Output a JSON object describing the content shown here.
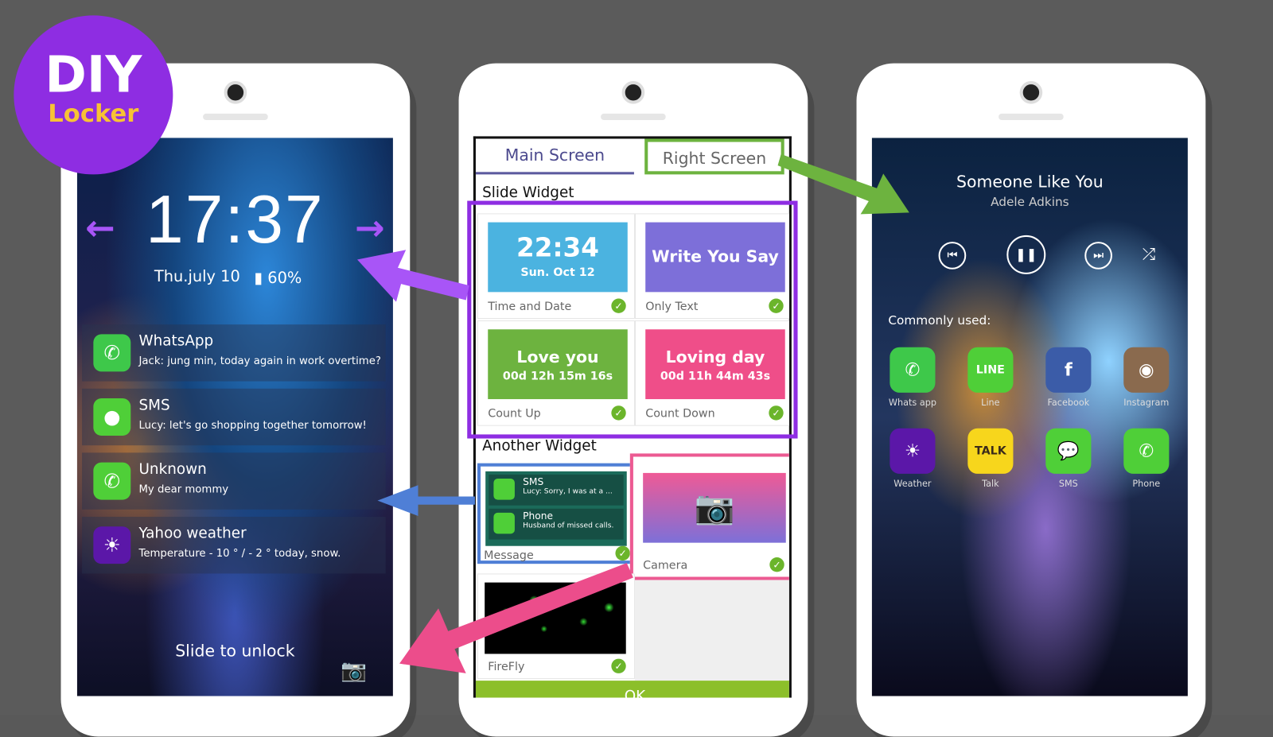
{
  "badge": {
    "title": "DIY",
    "subtitle": "Locker",
    "color": "#8e2de2"
  },
  "lock": {
    "time": "17:37",
    "date": "Thu.july 10",
    "battery": "60%",
    "left_arrow": "←",
    "right_arrow": "→",
    "notifications": [
      {
        "app": "WhatsApp",
        "message": "Jack: jung min, today again in work overtime?",
        "icon": "whatsapp-icon",
        "color": "#3ec84a"
      },
      {
        "app": "SMS",
        "message": "Lucy: let's go shopping together tomorrow!",
        "icon": "message-bubble-icon",
        "color": "#4fcf38"
      },
      {
        "app": "Unknown",
        "message": "My dear mommy",
        "icon": "phone-icon",
        "color": "#4fcf38"
      },
      {
        "app": "Yahoo weather",
        "message": "Temperature - 10 ° / - 2 ° today, snow.",
        "icon": "yahoo-weather-icon",
        "color": "#5b17a8"
      }
    ],
    "slide": "Slide to unlock"
  },
  "editor": {
    "tabs": [
      {
        "label": "Main Screen"
      },
      {
        "label": "Right Screen"
      }
    ],
    "slide_widget": "Slide Widget",
    "another_widget": "Another Widget",
    "widgets": [
      {
        "title": "22:34",
        "sub": "Sun. Oct 12",
        "label": "Time and Date",
        "color": "#4bb3e0"
      },
      {
        "title": "Write You Say",
        "sub": "",
        "label": "Only Text",
        "color": "#7d6fd9"
      },
      {
        "title": "Love you",
        "sub": "00d 12h 15m 16s",
        "label": "Count Up",
        "color": "#6db33f"
      },
      {
        "title": "Loving day",
        "sub": "00d 11h 44m 43s",
        "label": "Count Down",
        "color": "#ef4e89"
      }
    ],
    "message_widget": {
      "label": "Message",
      "items": [
        {
          "title": "SMS",
          "text": "Lucy: Sorry, I was at a ..."
        },
        {
          "title": "Phone",
          "text": "Husband of missed calls."
        }
      ]
    },
    "camera_widget": {
      "label": "Camera"
    },
    "firefly_widget": {
      "label": "FireFly"
    },
    "ok": "OK"
  },
  "music": {
    "song": "Someone Like You",
    "artist": "Adele Adkins",
    "controls": [
      "⏮",
      "❚❚",
      "⏭",
      "⤮"
    ],
    "commonly_used": "Commonly used:",
    "apps": [
      {
        "label": "Whats app",
        "glyph": "✆",
        "color": "#3ec84a"
      },
      {
        "label": "Line",
        "glyph": "LINE",
        "color": "#4fcf38"
      },
      {
        "label": "Facebook",
        "glyph": "f",
        "color": "#3b5ca8"
      },
      {
        "label": "Instagram",
        "glyph": "◉",
        "color": "#8a6a4e"
      },
      {
        "label": "Weather",
        "glyph": "☀",
        "color": "#5b17a8"
      },
      {
        "label": "Talk",
        "glyph": "TALK",
        "color": "#f7d61c"
      },
      {
        "label": "SMS",
        "glyph": "💬",
        "color": "#4fcf38"
      },
      {
        "label": "Phone",
        "glyph": "✆",
        "color": "#4fcf38"
      }
    ]
  }
}
